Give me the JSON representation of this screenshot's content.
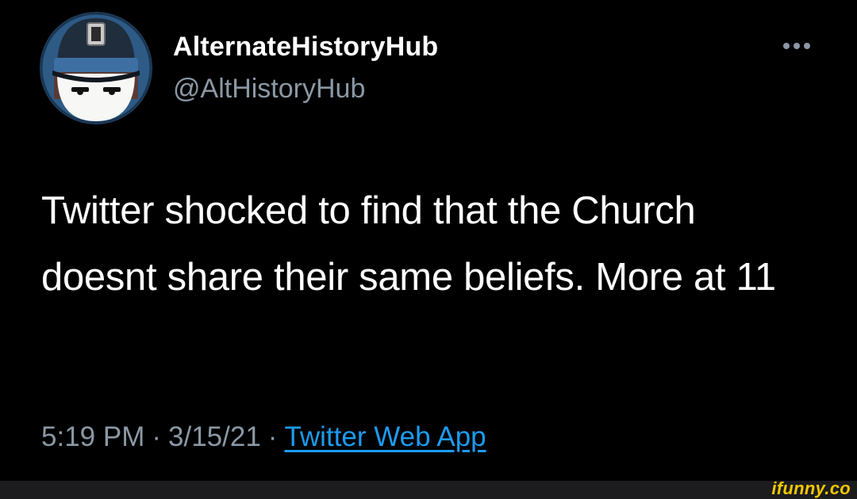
{
  "tweet": {
    "display_name": "AlternateHistoryHub",
    "handle": "@AltHistoryHub",
    "text": "Twitter shocked to find that the Church doesnt share their same beliefs. More at 11",
    "time": "5:19 PM",
    "separator": "·",
    "date": "3/15/21",
    "source": "Twitter Web App",
    "avatar_icon": "cartoon-officer-avatar",
    "more_icon": "more-options-icon"
  },
  "watermark": {
    "text": "ifunny.co"
  },
  "colors": {
    "background": "#000000",
    "primary_text": "#ffffff",
    "secondary_text": "#8b98a5",
    "link": "#1d9bf0",
    "watermark": "#f2c700"
  }
}
